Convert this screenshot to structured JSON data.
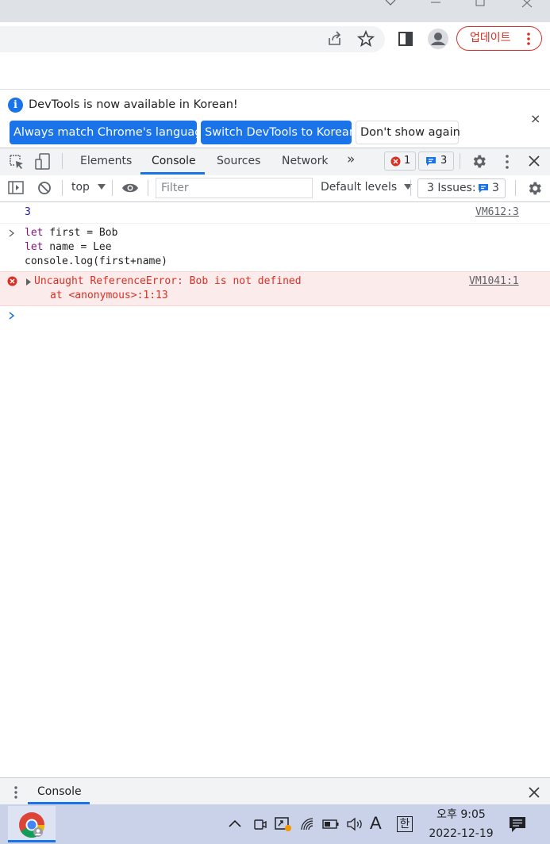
{
  "browser": {
    "update_label": "업데이트",
    "icons": [
      "share-icon",
      "star-icon",
      "side-panel-icon",
      "profile-icon",
      "menu-dots-icon"
    ]
  },
  "infobar": {
    "message": "DevTools is now available in Korean!",
    "btn_match": "Always match Chrome's language",
    "btn_switch": "Switch DevTools to Korean",
    "btn_dont_show": "Don't show again",
    "close": "×"
  },
  "devtools": {
    "tabs": [
      "Elements",
      "Console",
      "Sources",
      "Network"
    ],
    "more_tabs": "»",
    "error_count": "1",
    "message_count": "3",
    "close": "✕"
  },
  "console_toolbar": {
    "context": "top",
    "filter_placeholder": "Filter",
    "levels": "Default levels",
    "issues_label": "3 Issues:",
    "issues_count": "3"
  },
  "console": {
    "result_value": "3",
    "result_source": "VM612:3",
    "input_prompt": ">",
    "input_lines": [
      {
        "kw": "let",
        "rest": " first = Bob"
      },
      {
        "kw": "let",
        "rest": " name = Lee"
      },
      {
        "kw": "",
        "rest": "console.log(first+name)"
      }
    ],
    "error_message": "Uncaught ReferenceError: Bob is not defined",
    "error_stack": "at <anonymous>:1:13",
    "error_source": "VM1041:1",
    "prompt": ">"
  },
  "drawer": {
    "tab": "Console",
    "close": "✕"
  },
  "taskbar": {
    "time_ampm": "오후 9:05",
    "date": "2022-12-19",
    "ime_letter": "A",
    "ime_lang": "한"
  },
  "colors": {
    "accent": "#1a73e8",
    "error": "#d93025",
    "error_bg": "#fcebeb",
    "keyword": "#881280",
    "result_number": "#1a1aa6"
  }
}
